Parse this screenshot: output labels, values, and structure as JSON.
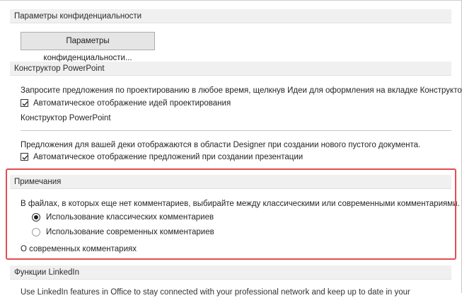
{
  "privacy": {
    "header": "Параметры конфиденциальности",
    "button_label": "Параметры конфиденциальности..."
  },
  "designer": {
    "header": "Конструктор PowerPoint",
    "description": "Запросите предложения по проектированию в любое время, щелкнув Идеи для оформления на вкладке Конструктор.",
    "auto_ideas_label": "Автоматическое отображение идей проектирования",
    "auto_ideas_checked": true,
    "subheading": "Конструктор PowerPoint",
    "deck_description": "Предложения для вашей деки отображаются в области Designer при создании нового пустого документа.",
    "auto_suggestions_label": "Автоматическое отображение предложений при создании презентации",
    "auto_suggestions_checked": true
  },
  "comments": {
    "header": "Примечания",
    "description": "В файлах, в которых еще нет комментариев, выбирайте между классическими или современными комментариями.",
    "options": [
      {
        "label": "Использование классических комментариев",
        "selected": true
      },
      {
        "label": "Использование современных комментариев",
        "selected": false
      }
    ],
    "link": "О современных комментариях"
  },
  "linkedin": {
    "header": "Функции LinkedIn",
    "description": "Use LinkedIn features in Office to stay connected with your professional network and keep up to date in your"
  },
  "colors": {
    "highlight_border": "#e34c50",
    "section_header_bg": "#f0f0f0"
  }
}
